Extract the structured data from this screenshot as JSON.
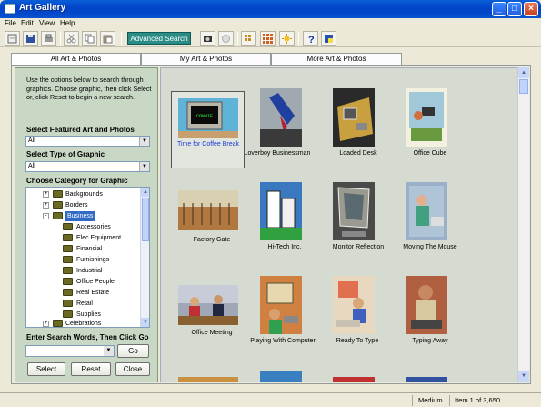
{
  "window": {
    "title": "Art Gallery"
  },
  "menu": [
    "File",
    "Edit",
    "View",
    "Help"
  ],
  "toolbar": {
    "advanced_search_label": "Advanced Search"
  },
  "tabs": [
    {
      "label": "All Art & Photos",
      "active": true
    },
    {
      "label": "My Art & Photos",
      "active": false
    },
    {
      "label": "More Art & Photos",
      "active": false
    }
  ],
  "sidebar": {
    "help_text": "Use the options below to search through graphics. Choose graphic, then click Select or, click Reset to begin a new search.",
    "featured_label": "Select Featured Art and Photos",
    "featured_value": "All",
    "type_label": "Select Type of Graphic",
    "type_value": "All",
    "category_label": "Choose Category for Graphic",
    "tree": [
      {
        "label": "Backgrounds",
        "level": 0,
        "expander": "+"
      },
      {
        "label": "Borders",
        "level": 0,
        "expander": "+"
      },
      {
        "label": "Business",
        "level": 0,
        "expander": "-",
        "selected": true
      },
      {
        "label": "Accessories",
        "level": 1
      },
      {
        "label": "Elec Equipment",
        "level": 1
      },
      {
        "label": "Financial",
        "level": 1
      },
      {
        "label": "Furnishings",
        "level": 1
      },
      {
        "label": "Industrial",
        "level": 1
      },
      {
        "label": "Office People",
        "level": 1
      },
      {
        "label": "Real Estate",
        "level": 1
      },
      {
        "label": "Retail",
        "level": 1
      },
      {
        "label": "Supplies",
        "level": 1
      },
      {
        "label": "Celebrations",
        "level": 0,
        "expander": "+"
      }
    ],
    "search_label": "Enter Search Words, Then Click Go",
    "search_value": "",
    "go_label": "Go",
    "select_label": "Select",
    "reset_label": "Reset",
    "close_label": "Close"
  },
  "gallery": {
    "items": [
      {
        "caption": "Time for Coffee Break",
        "selected": true,
        "screen_text": "CONNIE"
      },
      {
        "caption": "Loverboy Businessman"
      },
      {
        "caption": "Loaded Desk"
      },
      {
        "caption": "Office Cube"
      },
      {
        "caption": "Factory Gate"
      },
      {
        "caption": "Hi-Tech Inc."
      },
      {
        "caption": "Monitor Reflection"
      },
      {
        "caption": "Moving The Mouse"
      },
      {
        "caption": "Office Meeting"
      },
      {
        "caption": "Playing With Computer"
      },
      {
        "caption": "Ready To Type"
      },
      {
        "caption": "Typing Away"
      }
    ]
  },
  "status": {
    "size": "Medium",
    "count": "Item 1 of 3,650"
  },
  "colors": {
    "accent": "#316ac5",
    "sidebar_bg": "#c8d8c4",
    "gallery_bg": "#d5dbd0",
    "caption_selected": "#1c39d8"
  }
}
